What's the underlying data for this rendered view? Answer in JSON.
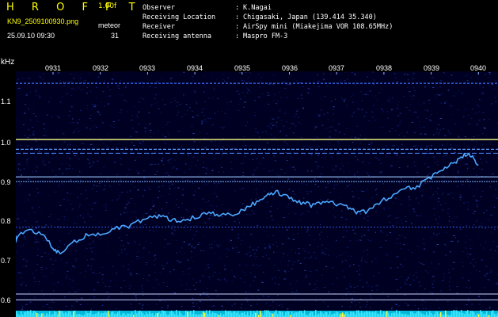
{
  "header": {
    "app_title": "H R O F F T",
    "version": "1.00f",
    "file_name": "KN9_2509100930.png",
    "meteor_label": "meteor",
    "meteor_count": "31",
    "datetime": "25.09.10 09:30"
  },
  "meta": [
    {
      "key": "Observer",
      "sep": ":",
      "value": "K.Nagai"
    },
    {
      "key": "Receiving Location",
      "sep": ":",
      "value": "Chigasaki, Japan (139.414 35.340)"
    },
    {
      "key": "Receiver",
      "sep": ":",
      "value": "AirSpy mini (Miakejima VOR 108.65MHz)"
    },
    {
      "key": "Receiving antenna",
      "sep": ":",
      "value": "Maspro FM-3"
    }
  ],
  "axis": {
    "unit_label": "kHz",
    "freq_ticks": [
      "1.1",
      "1.0",
      "0.9",
      "0.8",
      "0.7",
      "0.6"
    ],
    "time_ticks": [
      "0931",
      "0932",
      "0933",
      "0934",
      "0935",
      "0936",
      "0937",
      "0938",
      "0939",
      "0940"
    ]
  },
  "colors": {
    "background": "#000000",
    "spectrum_bg": "#000022",
    "noise": "#1a2fa0",
    "trace": "#4aa8ff",
    "carrier": "#ffffaa",
    "title": "#ffff00",
    "text": "#ffffff"
  },
  "chart_data": {
    "type": "heatmap",
    "x_unit": "time (HHMM)",
    "y_unit": "kHz",
    "ylim": [
      0.58,
      1.18
    ],
    "xlim": [
      "0930",
      "0940"
    ],
    "x_ticks": [
      "0931",
      "0932",
      "0933",
      "0934",
      "0935",
      "0936",
      "0937",
      "0938",
      "0939",
      "0940"
    ],
    "y_ticks": [
      1.1,
      1.0,
      0.9,
      0.8,
      0.7,
      0.6
    ],
    "horizontal_lines_khz": [
      1.153,
      1.01,
      0.985,
      0.975,
      0.915,
      0.903,
      0.787,
      0.617,
      0.602
    ],
    "trace_points": [
      {
        "t": 0.0,
        "f": 0.76
      },
      {
        "t": 0.2,
        "f": 0.755
      },
      {
        "t": 0.45,
        "f": 0.78
      },
      {
        "t": 0.75,
        "f": 0.77
      },
      {
        "t": 1.0,
        "f": 0.735
      },
      {
        "t": 1.15,
        "f": 0.72
      },
      {
        "t": 1.4,
        "f": 0.745
      },
      {
        "t": 1.7,
        "f": 0.765
      },
      {
        "t": 2.0,
        "f": 0.77
      },
      {
        "t": 2.3,
        "f": 0.785
      },
      {
        "t": 2.6,
        "f": 0.79
      },
      {
        "t": 2.9,
        "f": 0.805
      },
      {
        "t": 3.2,
        "f": 0.815
      },
      {
        "t": 3.45,
        "f": 0.808
      },
      {
        "t": 3.7,
        "f": 0.8
      },
      {
        "t": 4.0,
        "f": 0.812
      },
      {
        "t": 4.3,
        "f": 0.822
      },
      {
        "t": 4.55,
        "f": 0.816
      },
      {
        "t": 4.85,
        "f": 0.82
      },
      {
        "t": 5.1,
        "f": 0.835
      },
      {
        "t": 5.35,
        "f": 0.855
      },
      {
        "t": 5.55,
        "f": 0.875
      },
      {
        "t": 5.75,
        "f": 0.875
      },
      {
        "t": 6.0,
        "f": 0.86
      },
      {
        "t": 6.25,
        "f": 0.85
      },
      {
        "t": 6.5,
        "f": 0.842
      },
      {
        "t": 6.75,
        "f": 0.855
      },
      {
        "t": 7.0,
        "f": 0.843
      },
      {
        "t": 7.25,
        "f": 0.838
      },
      {
        "t": 7.45,
        "f": 0.822
      },
      {
        "t": 7.7,
        "f": 0.83
      },
      {
        "t": 7.9,
        "f": 0.85
      },
      {
        "t": 8.2,
        "f": 0.87
      },
      {
        "t": 8.45,
        "f": 0.885
      },
      {
        "t": 8.7,
        "f": 0.89
      },
      {
        "t": 9.0,
        "f": 0.915
      },
      {
        "t": 9.25,
        "f": 0.935
      },
      {
        "t": 9.5,
        "f": 0.952
      },
      {
        "t": 9.7,
        "f": 0.97
      },
      {
        "t": 9.85,
        "f": 0.97
      },
      {
        "t": 10.0,
        "f": 0.945
      }
    ],
    "bottom_strip": "signal activity"
  }
}
